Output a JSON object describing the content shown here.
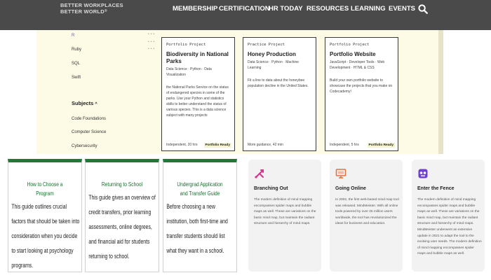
{
  "header": {
    "brand_line1": "BETTER WORKPLACES",
    "brand_line2": "BETTER WORLD",
    "nav": [
      "MEMBERSHIP",
      "CERTIFICATION",
      "HR TODAY",
      "RESOURCES",
      "LEARNING",
      "EVENTS"
    ]
  },
  "panel": {
    "languages": [
      "R",
      "Ruby",
      "SQL",
      "Swift"
    ],
    "subjects_heading": "Subjects",
    "subjects": [
      "Code Foundations",
      "Computer Science",
      "Cybersecurity"
    ],
    "cards": [
      {
        "kicker": "Portfolio Project",
        "title": "Biodiversity in National Parks",
        "tags": "Data Science · Python · Data Visualization",
        "desc": "the National Parks Service on the status of endangered species in some of the parks. Use your Python and statistics skills to better understand the status of various species. This is a data science subject with many projects",
        "foot": "Independent, 20 hrs",
        "badge": "Portfolio Ready"
      },
      {
        "kicker": "Practice Project",
        "title": "Honey Production",
        "tags": "Data Science · Python · Machine Learning",
        "desc": "Fit a line to data about the honeybee population decline in the United States.",
        "foot": "More guidance, 42 min",
        "badge": ""
      },
      {
        "kicker": "Portfolio Project",
        "title": "Portfolio Website",
        "tags": "JavaScript · Developer Tools · Web Development · HTML & CSS",
        "desc": "Build your own portfolio website to showcase the projects that you make on Codecademy!",
        "foot": "Independent, 5 hrs",
        "badge": "Portfolio Ready"
      }
    ]
  },
  "articles": [
    {
      "title": "How to Choose a Program",
      "desc": "This guide outlines crucial factors that should be taken into consideration when you decide to start looking at psychology programs."
    },
    {
      "title": "Returning to School",
      "desc": "This guide gives an overview of credit transfers, prior learning assessments, online degrees, and financial aid for students returning to school."
    },
    {
      "title": "Undergrad Application and Transfer Guide",
      "desc": "Before choosing a new institution, both first-time and transfer students should list what they want in a school."
    }
  ],
  "features": [
    {
      "icon": "branching-icon",
      "title": "Branching Out",
      "desc": "The modern definition of mind mapping encompasses spider maps and bubble maps as well. These are variations on the basic mind map, but maintain the radiant structure and hierarchy of mind maps."
    },
    {
      "icon": "monitor-icon",
      "title": "Going Online",
      "desc": "In 2002, the first web-based mind map tool was released. MindMeister. With all online tools powered by over 25 million users worldwide, the tool has revolutionized the ideas for business and education."
    },
    {
      "icon": "robot-icon",
      "title": "Enter the Fence",
      "desc": "The modern definition of mind mapping encompasses spider maps and bubble maps as well. These are variations on the basic mind map, but maintain the radiant structure and hierarchy of mind maps. MindMeister underwent an extensive update in 2021 to adapt the tool to the evolving user needs. The modern definition of mind mapping encompasses spider maps and bubble maps as well."
    }
  ],
  "colors": {
    "topbar": "#4a4a4a",
    "panel": "#fdfbe5",
    "green": "#1f7a37",
    "feature_bg": "#f3f2f2",
    "icon_pink": "#d6338a",
    "icon_orange": "#e0733f",
    "icon_purple": "#6f3fd1"
  }
}
